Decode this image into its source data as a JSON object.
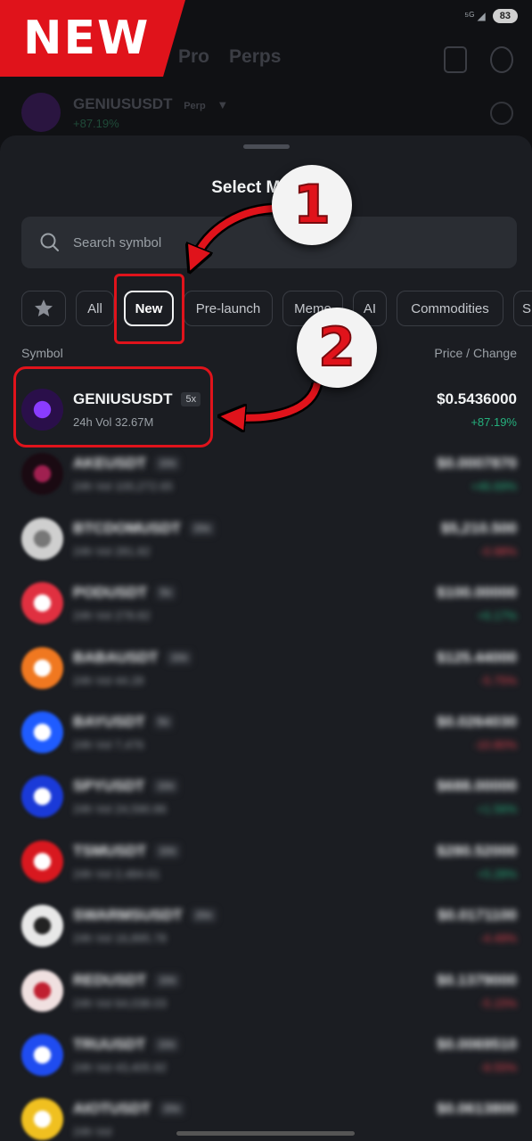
{
  "badge": {
    "label": "NEW"
  },
  "background": {
    "tabs": [
      "Pro",
      "Perps"
    ],
    "symbol": "GENIUSUSDT",
    "symbol_tag": "Perp",
    "change": "+87.19%",
    "battery": "83"
  },
  "sheet": {
    "title": "Select Market",
    "search_placeholder": "Search symbol",
    "filters": [
      "All",
      "New",
      "Pre-launch",
      "Meme",
      "AI",
      "Commodities",
      "S"
    ],
    "active_filter": "New",
    "col_symbol": "Symbol",
    "col_price": "Price / Change"
  },
  "rows": [
    {
      "name": "GENIUSUSDT",
      "lev": "5x",
      "vol": "24h Vol 32.67M",
      "price": "$0.5436000",
      "chg": "+87.19%",
      "dir": "up",
      "logo_color": "#2a0f4a",
      "logo_accent": "#8a3cff"
    },
    {
      "name": "AKEUSDT",
      "lev": "10x",
      "vol": "24h Vol 100,272.65",
      "price": "$0.0007870",
      "chg": "+46.69%",
      "dir": "up",
      "logo_color": "#1a0a12",
      "logo_accent": "#a02050"
    },
    {
      "name": "BTCDOMUSDT",
      "lev": "20x",
      "vol": "24h Vol 281.82",
      "price": "$5,210.500",
      "chg": "-0.98%",
      "dir": "down",
      "logo_color": "#cfcfcf",
      "logo_accent": "#777777"
    },
    {
      "name": "PODUSDT",
      "lev": "5x",
      "vol": "24h Vol 278.82",
      "price": "$100.00000",
      "chg": "+6.17%",
      "dir": "up",
      "logo_color": "#e03040",
      "logo_accent": "#ffffff"
    },
    {
      "name": "BABAUSDT",
      "lev": "10x",
      "vol": "24h Vol 44.28",
      "price": "$125.44000",
      "chg": "-5.75%",
      "dir": "down",
      "logo_color": "#f07820",
      "logo_accent": "#ffffff"
    },
    {
      "name": "BAYUSDT",
      "lev": "5x",
      "vol": "24h Vol 7,476",
      "price": "$0.0264030",
      "chg": "-10.80%",
      "dir": "down",
      "logo_color": "#1f5cff",
      "logo_accent": "#ffffff"
    },
    {
      "name": "SPYUSDT",
      "lev": "10x",
      "vol": "24h Vol 24,590.86",
      "price": "$688.00000",
      "chg": "+1.56%",
      "dir": "up",
      "logo_color": "#1a3ad8",
      "logo_accent": "#ffffff"
    },
    {
      "name": "TSMUSDT",
      "lev": "10x",
      "vol": "24h Vol 2,484.61",
      "price": "$280.52000",
      "chg": "+5.28%",
      "dir": "up",
      "logo_color": "#d8181f",
      "logo_accent": "#ffffff"
    },
    {
      "name": "SWARMSUSDT",
      "lev": "20x",
      "vol": "24h Vol 16,895.78",
      "price": "$0.0171100",
      "chg": "-4.49%",
      "dir": "down",
      "logo_color": "#e8e8e8",
      "logo_accent": "#222222"
    },
    {
      "name": "REDUSDT",
      "lev": "10x",
      "vol": "24h Vol 64,038.03",
      "price": "$0.1379000",
      "chg": "-5.15%",
      "dir": "down",
      "logo_color": "#f0e0e0",
      "logo_accent": "#c02030"
    },
    {
      "name": "TRUUSDT",
      "lev": "10x",
      "vol": "24h Vol 43,405.92",
      "price": "$0.0069510",
      "chg": "-9.55%",
      "dir": "down",
      "logo_color": "#1f4cf0",
      "logo_accent": "#ffffff"
    },
    {
      "name": "AIOTUSDT",
      "lev": "20x",
      "vol": "24h Vol",
      "price": "$0.0613800",
      "chg": "",
      "dir": "up",
      "logo_color": "#f0c020",
      "logo_accent": "#ffffff"
    }
  ],
  "annotations": {
    "step1": "1",
    "step2": "2"
  },
  "colors": {
    "accent_red": "#e0131b",
    "up": "#25b07d",
    "down": "#e0424f"
  }
}
